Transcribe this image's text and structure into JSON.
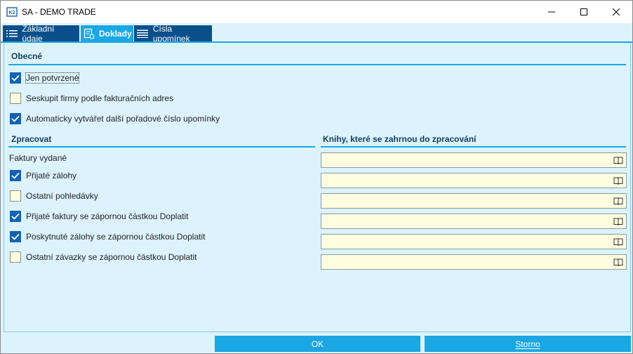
{
  "window": {
    "title": "SA - DEMO TRADE"
  },
  "tabs": [
    {
      "label": "Základní údaje",
      "icon": "list-icon"
    },
    {
      "label": "Doklady",
      "icon": "document-gear-icon"
    },
    {
      "label": "Čísla upomínek",
      "icon": "list-icon"
    }
  ],
  "general": {
    "title": "Obecné",
    "options": [
      {
        "label": "Jen potvrzené",
        "checked": true
      },
      {
        "label": "Seskupit firmy podle fakturačních adres",
        "checked": false
      },
      {
        "label": "Automaticky vytvářet další pořadové číslo upomínky",
        "checked": true
      }
    ]
  },
  "process": {
    "title": "Zpracovat",
    "static_item": "Faktury vydané",
    "options": [
      {
        "label": "Přijaté zálohy",
        "checked": true
      },
      {
        "label": "Ostatní pohledávky",
        "checked": false
      },
      {
        "label": "Přijaté faktury se zápornou částkou Doplatit",
        "checked": true
      },
      {
        "label": "Poskytnuté zálohy se zápornou částkou Doplatit",
        "checked": true
      },
      {
        "label": "Ostatní závazky se zápornou částkou Doplatit",
        "checked": false
      }
    ]
  },
  "books": {
    "title": "Knihy, které se zahrnou do zpracování",
    "fields": [
      "",
      "",
      "",
      "",
      "",
      ""
    ],
    "icon": "book-icon"
  },
  "footer": {
    "ok_label": "OK",
    "cancel_label": "Storno"
  },
  "colors": {
    "accent": "#1aa7e3",
    "tab_dark": "#0a4f8c",
    "panel": "#dcf3fd",
    "field": "#fffde0",
    "check": "#1461b4"
  }
}
